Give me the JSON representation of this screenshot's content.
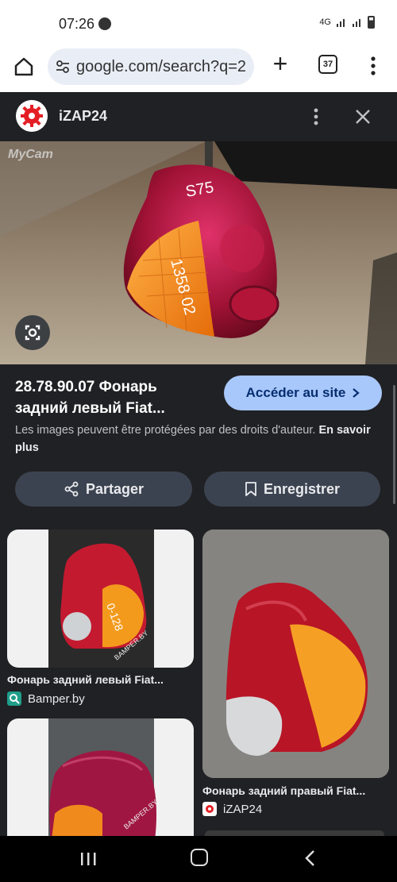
{
  "status_bar": {
    "time": "07:26",
    "network": "4G"
  },
  "browser": {
    "url": "google.com/search?q=2",
    "tab_count": "37"
  },
  "sheet": {
    "site_name": "iZAP24",
    "watermark": "MyCam",
    "title_line1": "28.78.90.07 Фонарь",
    "title_line2": "задний левый Fiat...",
    "visit_label": "Accéder au site",
    "copyright_text": "Les images peuvent être protégées par des droits d'auteur.",
    "learn_more": "En savoir plus",
    "share_label": "Partager",
    "save_label": "Enregistrer"
  },
  "results": [
    {
      "caption": "Фонарь задний левый Fiat...",
      "source": "Bamper.by",
      "image_text": "0-128",
      "watermark": "BAMPER.BY"
    },
    {
      "caption": "Фонарь задний правый Fiat...",
      "source": "iZAP24"
    },
    {
      "watermark": "BAMPER.BY"
    }
  ],
  "colors": {
    "accent_button": "#a8c7fa",
    "dark_bg": "#202124",
    "chip_bg": "#3c4350",
    "izap_red": "#e31e24"
  }
}
